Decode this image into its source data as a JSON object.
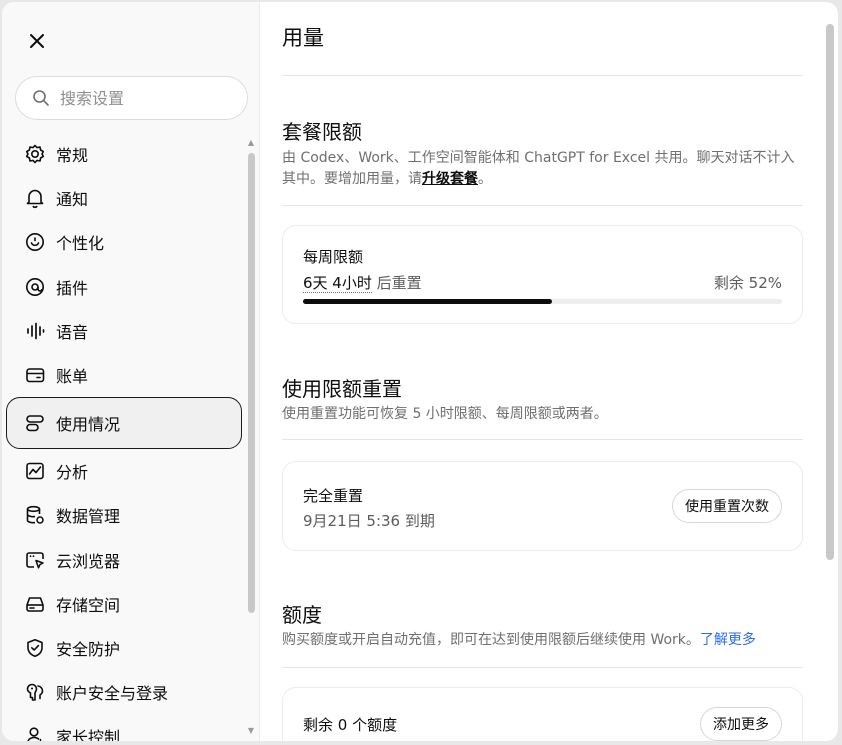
{
  "sidebar": {
    "search": {
      "placeholder": "搜索设置"
    },
    "items": [
      {
        "key": "general",
        "label": "常规",
        "icon": "gear-icon"
      },
      {
        "key": "notifications",
        "label": "通知",
        "icon": "bell-icon"
      },
      {
        "key": "personalization",
        "label": "个性化",
        "icon": "personalization-icon"
      },
      {
        "key": "plugins",
        "label": "插件",
        "icon": "plugin-icon"
      },
      {
        "key": "voice",
        "label": "语音",
        "icon": "waveform-icon"
      },
      {
        "key": "billing",
        "label": "账单",
        "icon": "wallet-icon"
      },
      {
        "key": "usage",
        "label": "使用情况",
        "icon": "usage-icon",
        "active": true
      },
      {
        "key": "analytics",
        "label": "分析",
        "icon": "chart-icon"
      },
      {
        "key": "data",
        "label": "数据管理",
        "icon": "database-icon"
      },
      {
        "key": "cloud-browser",
        "label": "云浏览器",
        "icon": "browser-icon"
      },
      {
        "key": "storage",
        "label": "存储空间",
        "icon": "storage-icon"
      },
      {
        "key": "security",
        "label": "安全防护",
        "icon": "shield-icon"
      },
      {
        "key": "account-security",
        "label": "账户安全与登录",
        "icon": "key-icon"
      },
      {
        "key": "parental",
        "label": "家长控制",
        "icon": "person-icon"
      }
    ]
  },
  "main": {
    "title": "用量",
    "plan_limits": {
      "title": "套餐限额",
      "desc_before": "由 Codex、Work、工作空间智能体和 ChatGPT for Excel 共用。聊天对话不计入其中。要增加用量，请",
      "desc_link": "升级套餐",
      "desc_after": "。",
      "weekly": {
        "label": "每周限额",
        "reset_time": "6天 4小时",
        "reset_suffix": " 后重置",
        "remaining": "剩余 52%",
        "used_fraction": 0.52
      }
    },
    "reset": {
      "title": "使用限额重置",
      "desc": "使用重置功能可恢复 5 小时限额、每周限额或两者。",
      "card": {
        "label": "完全重置",
        "expiry": "9月21日 5:36 到期",
        "button": "使用重置次数"
      }
    },
    "credits": {
      "title": "额度",
      "desc": "购买额度或开启自动充值，即可在达到使用限额后继续使用 Work。",
      "link": "了解更多",
      "card": {
        "label": "剩余 0 个额度",
        "button": "添加更多"
      }
    }
  }
}
